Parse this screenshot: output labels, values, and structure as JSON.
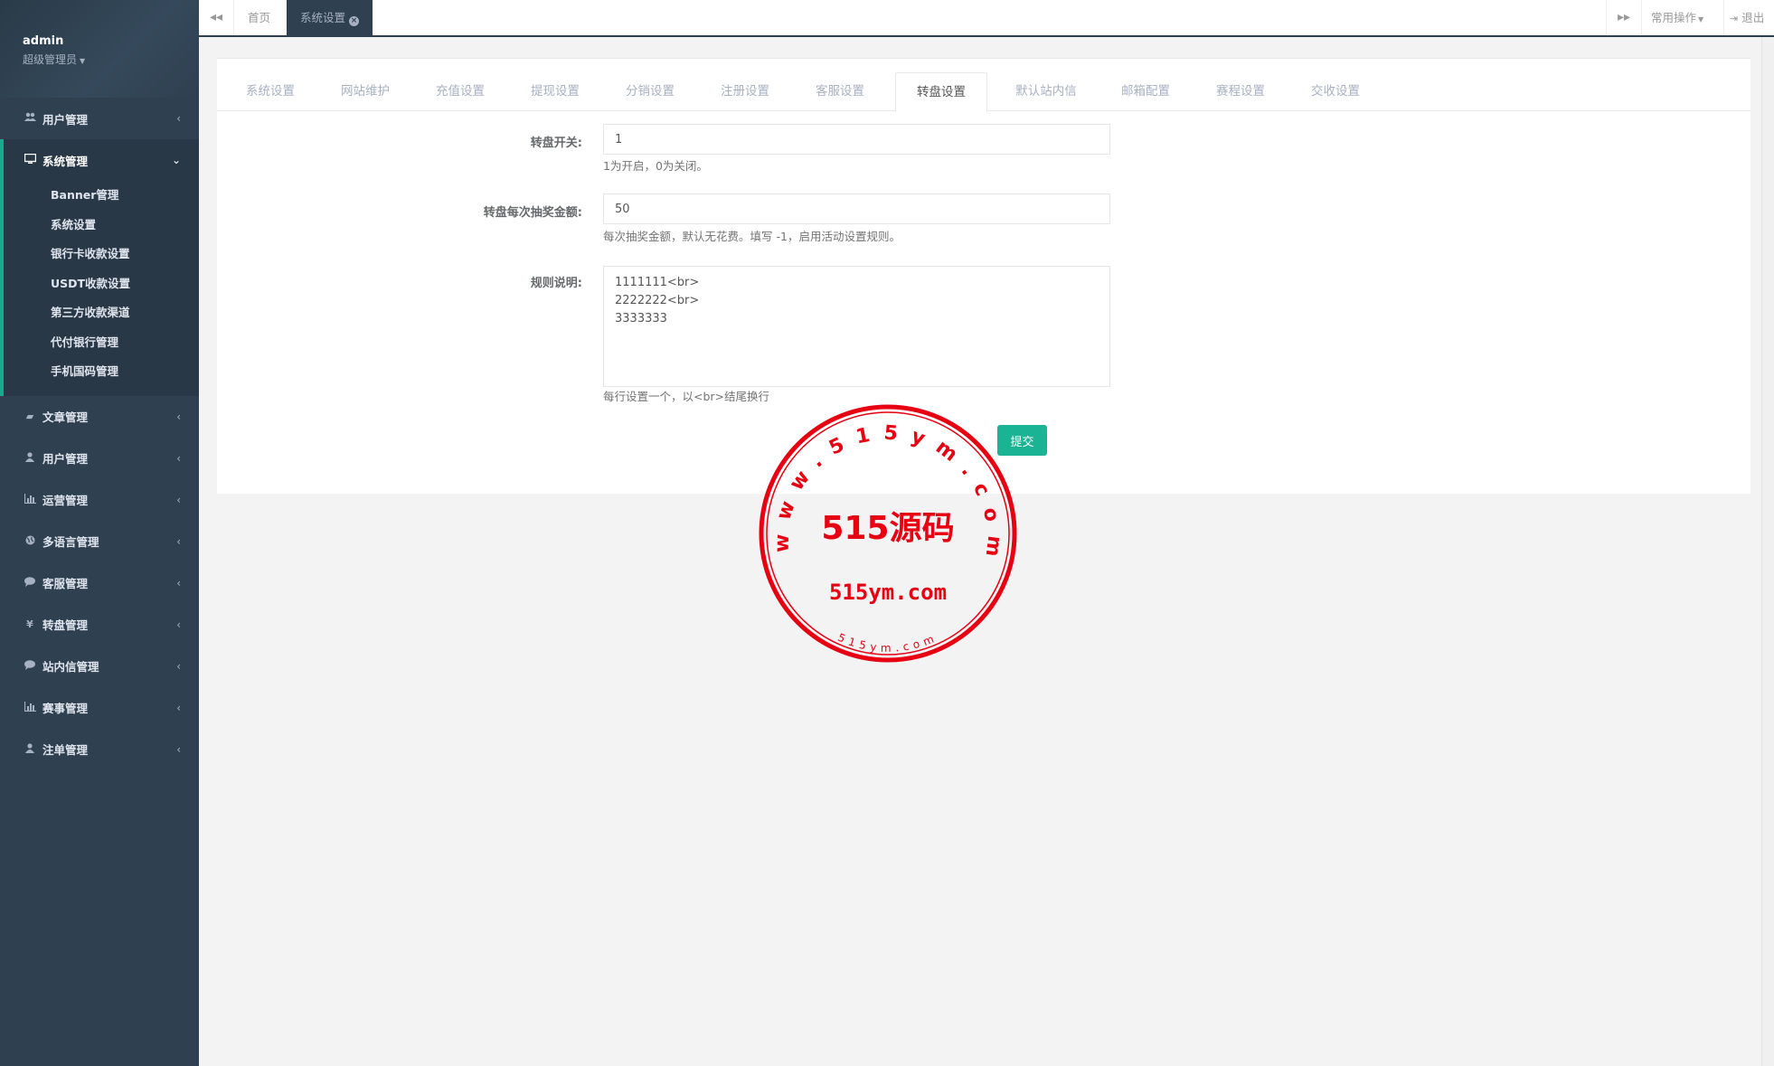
{
  "profile": {
    "name": "admin",
    "role": "超级管理员"
  },
  "sidebar": {
    "top_item": {
      "label": "用户管理",
      "icon": "users-icon"
    },
    "open_group": {
      "label": "系统管理",
      "icon": "desktop-icon",
      "items": [
        "Banner管理",
        "系统设置",
        "银行卡收款设置",
        "USDT收款设置",
        "第三方收款渠道",
        "代付银行管理",
        "手机国码管理"
      ]
    },
    "items": [
      {
        "label": "文章管理",
        "icon": "book-icon"
      },
      {
        "label": "用户管理",
        "icon": "user-icon"
      },
      {
        "label": "运营管理",
        "icon": "bar-chart-icon"
      },
      {
        "label": "多语言管理",
        "icon": "globe-icon"
      },
      {
        "label": "客服管理",
        "icon": "comment-icon"
      },
      {
        "label": "转盘管理",
        "icon": "yen-icon"
      },
      {
        "label": "站内信管理",
        "icon": "comment-icon"
      },
      {
        "label": "赛事管理",
        "icon": "bar-chart-icon"
      },
      {
        "label": "注单管理",
        "icon": "user-icon"
      }
    ]
  },
  "topbar": {
    "tabs": [
      {
        "label": "首页",
        "active": false
      },
      {
        "label": "系统设置",
        "active": true
      }
    ],
    "common_ops": "常用操作",
    "logout": "退出"
  },
  "settings_tabs": [
    "系统设置",
    "网站维护",
    "充值设置",
    "提现设置",
    "分销设置",
    "注册设置",
    "客服设置",
    "转盘设置",
    "默认站内信",
    "邮箱配置",
    "赛程设置",
    "交收设置"
  ],
  "active_settings_tab": "转盘设置",
  "form": {
    "switch": {
      "label": "转盘开关:",
      "value": "1",
      "help": "1为开启，0为关闭。"
    },
    "amount": {
      "label": "转盘每次抽奖金额:",
      "value": "50",
      "help": "每次抽奖金额，默认无花费。填写 -1，启用活动设置规则。"
    },
    "rules": {
      "label": "规则说明:",
      "value": "1111111<br>\n2222222<br>\n3333333",
      "help": "每行设置一个，以<br>结尾换行"
    },
    "submit": "提交"
  },
  "stamp": {
    "arc_text": "www.515ym.com",
    "center_text": "515源码",
    "sub_text": "515ym.com",
    "bottom_text": "515ym.com",
    "color": "#e60012"
  }
}
